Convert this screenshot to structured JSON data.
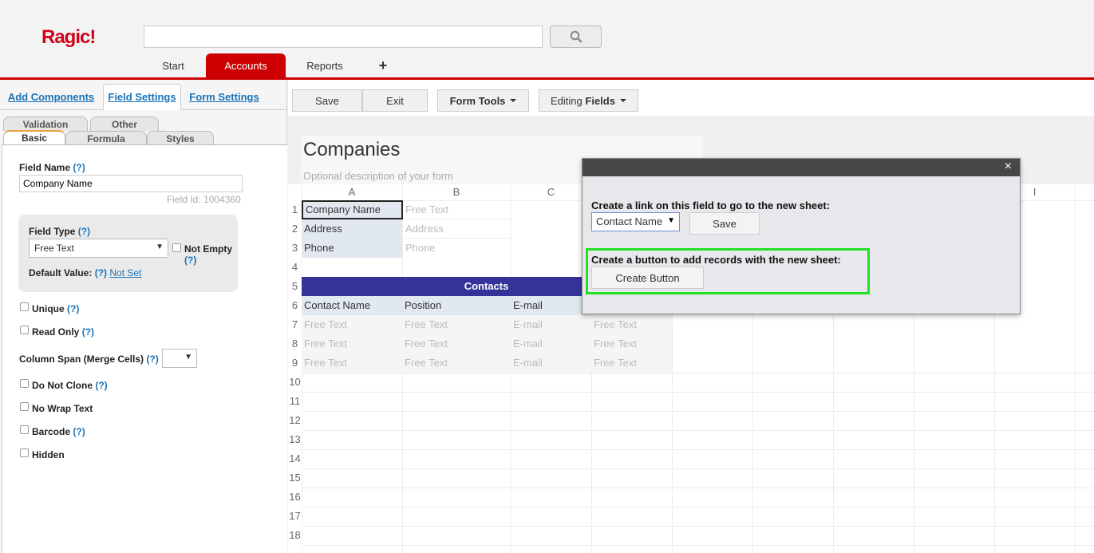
{
  "app": {
    "logo": "Ragic!"
  },
  "search": {
    "placeholder": ""
  },
  "nav": {
    "tabs": [
      {
        "label": "Start"
      },
      {
        "label": "Accounts"
      },
      {
        "label": "Reports"
      },
      {
        "label": "+"
      }
    ]
  },
  "left_panel": {
    "top_tabs": [
      "Add Components",
      "Field Settings",
      "Form Settings"
    ],
    "sub_tabs_row1": [
      "Validation",
      "Other"
    ],
    "sub_tabs_row2": [
      "Basic",
      "Formula",
      "Styles"
    ],
    "field_name_label": "Field Name",
    "help": "(?)",
    "field_name_value": "Company Name",
    "field_id": "Field Id: 1004360",
    "field_type_label": "Field Type",
    "field_type_value": "Free Text",
    "not_empty": "Not Empty",
    "default_value_label": "Default Value:",
    "default_value_link": "Not Set",
    "unique": "Unique",
    "read_only": "Read Only",
    "column_span": "Column Span (Merge Cells)",
    "do_not_clone": "Do Not Clone",
    "no_wrap": "No Wrap Text",
    "barcode": "Barcode",
    "hidden": "Hidden"
  },
  "toolbar": {
    "save": "Save",
    "exit": "Exit",
    "form_tools": "Form Tools",
    "editing_prefix": "Editing",
    "editing_bold": "Fields"
  },
  "form": {
    "title": "Companies",
    "description": "Optional description of your form"
  },
  "sheet": {
    "columns": [
      "A",
      "B",
      "C",
      "I"
    ],
    "rows": [
      "1",
      "2",
      "3",
      "4",
      "5",
      "6",
      "7",
      "8",
      "9",
      "10",
      "11",
      "12",
      "13",
      "14",
      "15",
      "16",
      "17",
      "18"
    ],
    "r1": {
      "a": "Company Name",
      "b": "Free Text"
    },
    "r2": {
      "a": "Address",
      "b": "Address"
    },
    "r3": {
      "a": "Phone",
      "b": "Phone"
    },
    "subtable_title": "Contacts",
    "sub_headers": [
      "Contact Name",
      "Position",
      "E-mail"
    ],
    "sub_rows": [
      [
        "Free Text",
        "Free Text",
        "E-mail",
        "Free Text"
      ],
      [
        "Free Text",
        "Free Text",
        "E-mail",
        "Free Text"
      ],
      [
        "Free Text",
        "Free Text",
        "E-mail",
        "Free Text"
      ]
    ]
  },
  "dialog": {
    "close": "×",
    "link_text": "Create a link on this field to go to the new sheet:",
    "link_select": "Contact Name",
    "save": "Save",
    "button_text": "Create a button to add records with the new sheet:",
    "create_button": "Create Button"
  },
  "colors": {
    "brand": "#cc0000",
    "subtable_header": "#333399",
    "highlight": "#22e022"
  }
}
